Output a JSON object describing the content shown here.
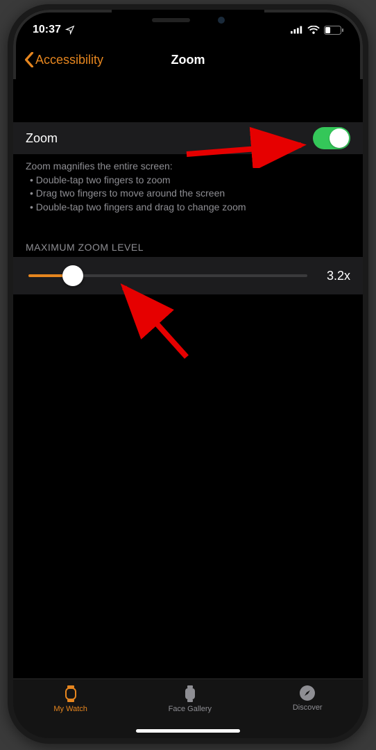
{
  "status": {
    "time": "10:37"
  },
  "nav": {
    "back_label": "Accessibility",
    "title": "Zoom"
  },
  "zoom": {
    "label": "Zoom",
    "footer_intro": "Zoom magnifies the entire screen:",
    "footer_items": [
      "Double-tap two fingers to zoom",
      "Drag two fingers to move around the screen",
      "Double-tap two fingers and drag to change zoom"
    ]
  },
  "slider": {
    "header": "MAXIMUM ZOOM LEVEL",
    "value": "3.2x"
  },
  "tabs": {
    "my_watch": "My Watch",
    "face_gallery": "Face Gallery",
    "discover": "Discover"
  }
}
